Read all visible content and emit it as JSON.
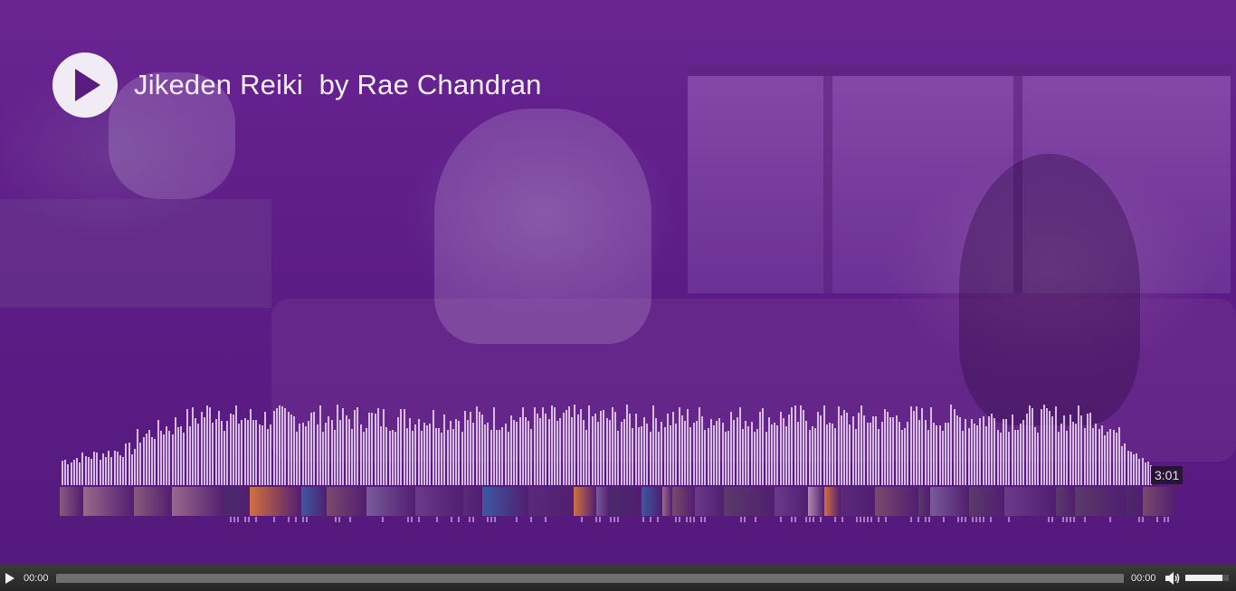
{
  "header": {
    "title": "Jikeden Reiki  by Rae Chandran"
  },
  "waveform": {
    "time_label": "3:01",
    "bar_color": "#f0e1f5"
  },
  "player": {
    "current_time": "00:00",
    "duration": "00:00",
    "progress_fraction": 0,
    "volume_fraction": 0.85
  },
  "icons": {
    "big_play": "play-icon",
    "ctrl_play": "play-icon",
    "mute": "speaker-icon"
  },
  "colors": {
    "overlay": "#5e1d88",
    "play_circle": "#f1ebf5",
    "play_glyph": "#5a1a7e",
    "control_bar": "#2e2e2e"
  }
}
